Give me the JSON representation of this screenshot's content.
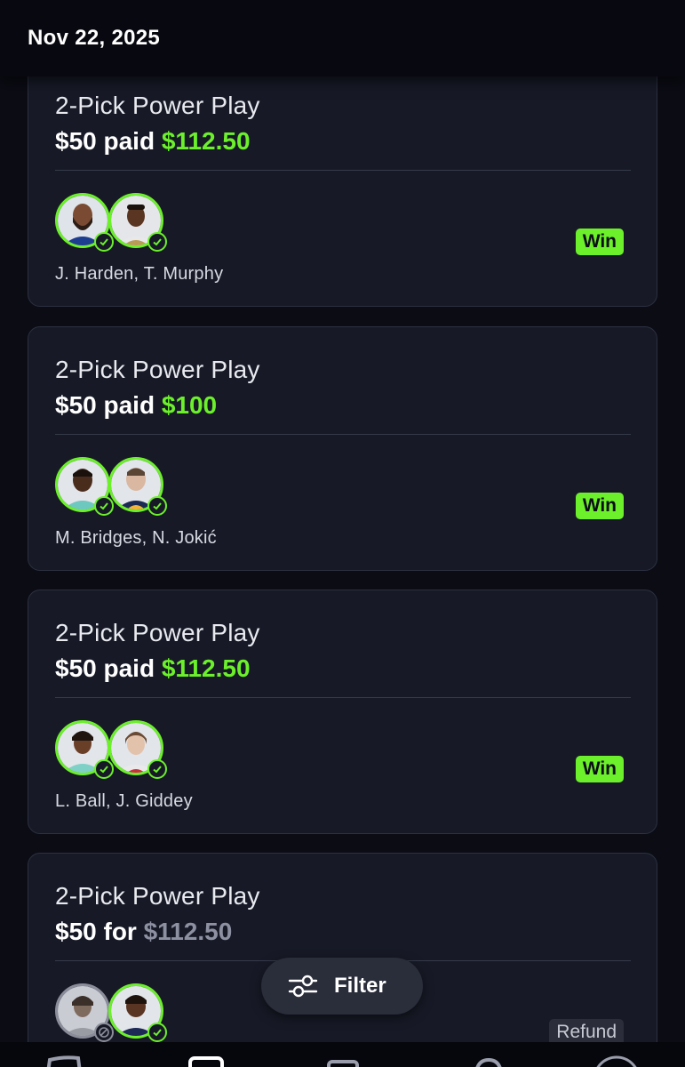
{
  "header": {
    "date": "Nov 22, 2025"
  },
  "entries": [
    {
      "title": "2-Pick Power Play",
      "stake": "$50",
      "connector": "paid",
      "payout": "$112.50",
      "players": "J. Harden, T. Murphy",
      "result": "Win"
    },
    {
      "title": "2-Pick Power Play",
      "stake": "$50",
      "connector": "paid",
      "payout": "$100",
      "players": "M. Bridges, N. Jokić",
      "result": "Win"
    },
    {
      "title": "2-Pick Power Play",
      "stake": "$50",
      "connector": "paid",
      "payout": "$112.50",
      "players": "L. Ball, J. Giddey",
      "result": "Win"
    },
    {
      "title": "2-Pick Power Play",
      "stake": "$50",
      "connector": "for",
      "payout": "$112.50",
      "players": "",
      "result": "Refund"
    }
  ],
  "filter": {
    "label": "Filter",
    "icon": "sliders-icon"
  },
  "colors": {
    "accent_green": "#6cf02b",
    "card_bg": "#171a26",
    "page_bg": "#0b0c14",
    "muted": "#8d90a0"
  }
}
